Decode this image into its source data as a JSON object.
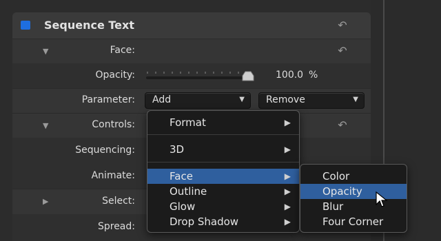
{
  "header": {
    "title": "Sequence Text",
    "reset_icon": "reset-arrow-icon",
    "swatch_color": "#1e6ee0"
  },
  "face": {
    "label": "Face:"
  },
  "opacity": {
    "label": "Opacity:",
    "value": "100.0",
    "unit": "%",
    "level": 1.0
  },
  "parameter": {
    "label": "Parameter:",
    "add_label": "Add",
    "remove_label": "Remove"
  },
  "controls": {
    "label": "Controls:"
  },
  "rows": {
    "sequencing": "Sequencing:",
    "animate": "Animate:",
    "select": "Select:",
    "spread": "Spread:"
  },
  "add_menu": {
    "items": [
      "Format",
      "3D",
      "Face",
      "Outline",
      "Glow",
      "Drop Shadow"
    ]
  },
  "face_submenu": {
    "items": [
      "Color",
      "Opacity",
      "Blur",
      "Four Corner"
    ]
  },
  "colors": {
    "accent": "#2f5f9e",
    "swatch": "#1e6ee0"
  }
}
